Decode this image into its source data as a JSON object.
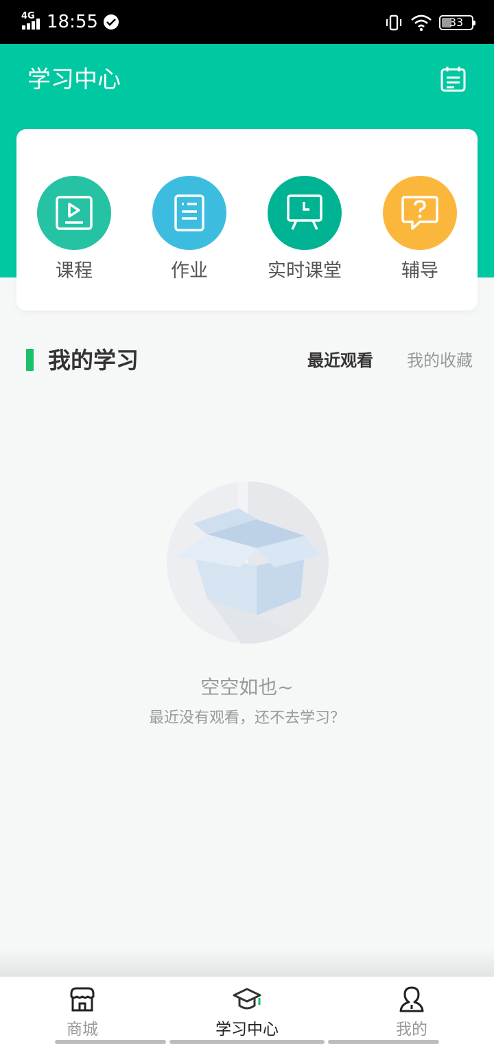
{
  "status_bar": {
    "network": "4G",
    "time": "18:55",
    "battery": "33"
  },
  "header": {
    "title": "学习中心",
    "calendar_icon": "calendar-list-icon",
    "background_color": "#00c8a1"
  },
  "shortcuts": [
    {
      "label": "课程",
      "icon": "video-play-icon",
      "color": "#26c2a4"
    },
    {
      "label": "作业",
      "icon": "document-list-icon",
      "color": "#3cbde0"
    },
    {
      "label": "实时课堂",
      "icon": "live-classroom-icon",
      "color": "#00b393"
    },
    {
      "label": "辅导",
      "icon": "question-bubble-icon",
      "color": "#fbb73c"
    }
  ],
  "my_study": {
    "title": "我的学习",
    "tabs": [
      {
        "label": "最近观看",
        "active": true
      },
      {
        "label": "我的收藏",
        "active": false
      }
    ],
    "accent_color": "#1bc06b"
  },
  "empty_state": {
    "illustration": "empty-box-icon",
    "title": "空空如也~",
    "subtitle": "最近没有观看，还不去学习？"
  },
  "bottom_nav": [
    {
      "label": "商城",
      "icon": "store-icon",
      "active": false
    },
    {
      "label": "学习中心",
      "icon": "graduation-cap-icon",
      "active": true
    },
    {
      "label": "我的",
      "icon": "user-icon",
      "active": false
    }
  ]
}
